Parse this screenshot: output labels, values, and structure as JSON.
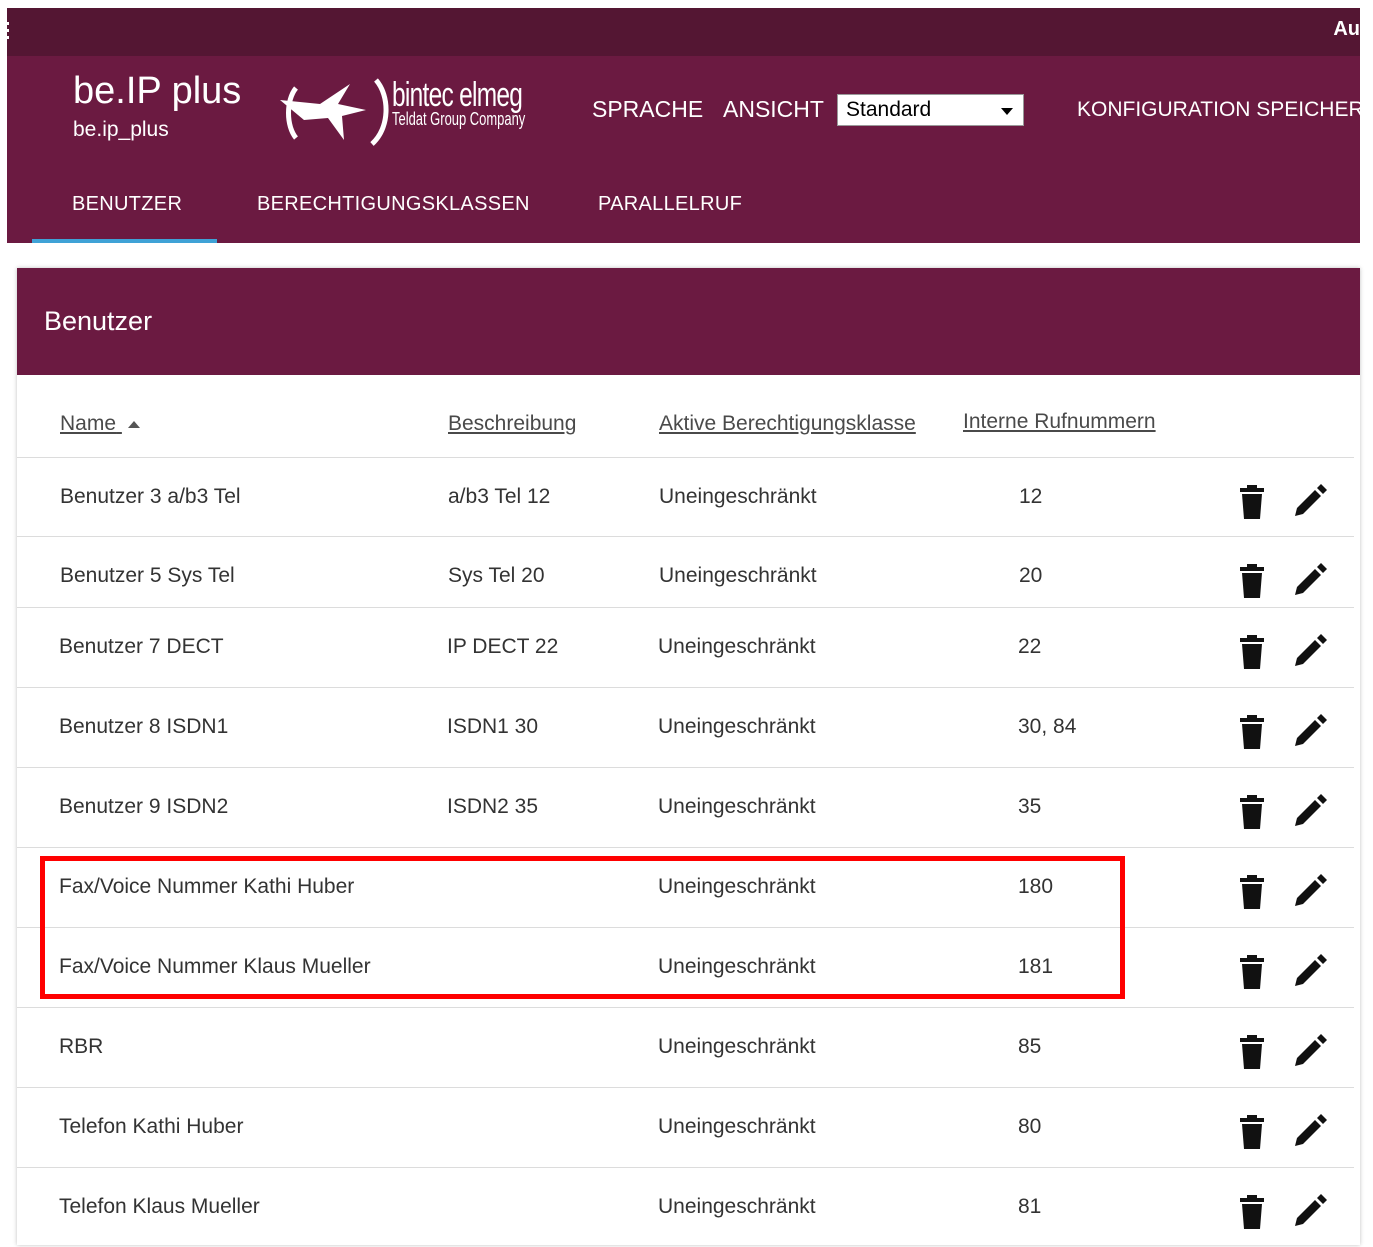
{
  "topbar": {
    "right_text": "Au"
  },
  "brand": {
    "title": "be.IP plus",
    "subtitle": "be.ip_plus"
  },
  "logo": {
    "name": "bintec elmeg",
    "tagline": "Teldat Group Company"
  },
  "header_nav": {
    "language": "SPRACHE",
    "view": "ANSICHT",
    "view_select_value": "Standard",
    "save_config": "KONFIGURATION SPEICHERN"
  },
  "tabs": [
    {
      "label": "BENUTZER",
      "active": true
    },
    {
      "label": "BERECHTIGUNGSKLASSEN",
      "active": false
    },
    {
      "label": "PARALLELRUF",
      "active": false
    }
  ],
  "panel": {
    "title": "Benutzer"
  },
  "table": {
    "headers": {
      "name": "Name",
      "description": "Beschreibung",
      "class": "Aktive Berechtigungsklasse",
      "numbers": "Interne Rufnummern"
    },
    "rows": [
      {
        "name": "Benutzer 3 a/b3 Tel",
        "description": "a/b3 Tel 12",
        "class": "Uneingeschränkt",
        "numbers": "12"
      },
      {
        "name": "Benutzer 5 Sys Tel",
        "description": "Sys Tel 20",
        "class": "Uneingeschränkt",
        "numbers": "20"
      },
      {
        "name": "Benutzer 7 DECT",
        "description": "IP DECT 22",
        "class": "Uneingeschränkt",
        "numbers": "22"
      },
      {
        "name": "Benutzer 8 ISDN1",
        "description": "ISDN1 30",
        "class": "Uneingeschränkt",
        "numbers": "30, 84"
      },
      {
        "name": "Benutzer 9 ISDN2",
        "description": "ISDN2 35",
        "class": "Uneingeschränkt",
        "numbers": "35"
      },
      {
        "name": "Fax/Voice Nummer Kathi Huber",
        "description": "",
        "class": "Uneingeschränkt",
        "numbers": "180"
      },
      {
        "name": "Fax/Voice Nummer Klaus Mueller",
        "description": "",
        "class": "Uneingeschränkt",
        "numbers": "181"
      },
      {
        "name": "RBR",
        "description": "",
        "class": "Uneingeschränkt",
        "numbers": "85"
      },
      {
        "name": "Telefon Kathi Huber",
        "description": "",
        "class": "Uneingeschränkt",
        "numbers": "80"
      },
      {
        "name": "Telefon Klaus Mueller",
        "description": "",
        "class": "Uneingeschränkt",
        "numbers": "81"
      }
    ]
  },
  "colors": {
    "brand": "#6b1a41",
    "topbar": "#541633",
    "tab_accent": "#3fa2d6",
    "highlight": "#ff0000"
  }
}
